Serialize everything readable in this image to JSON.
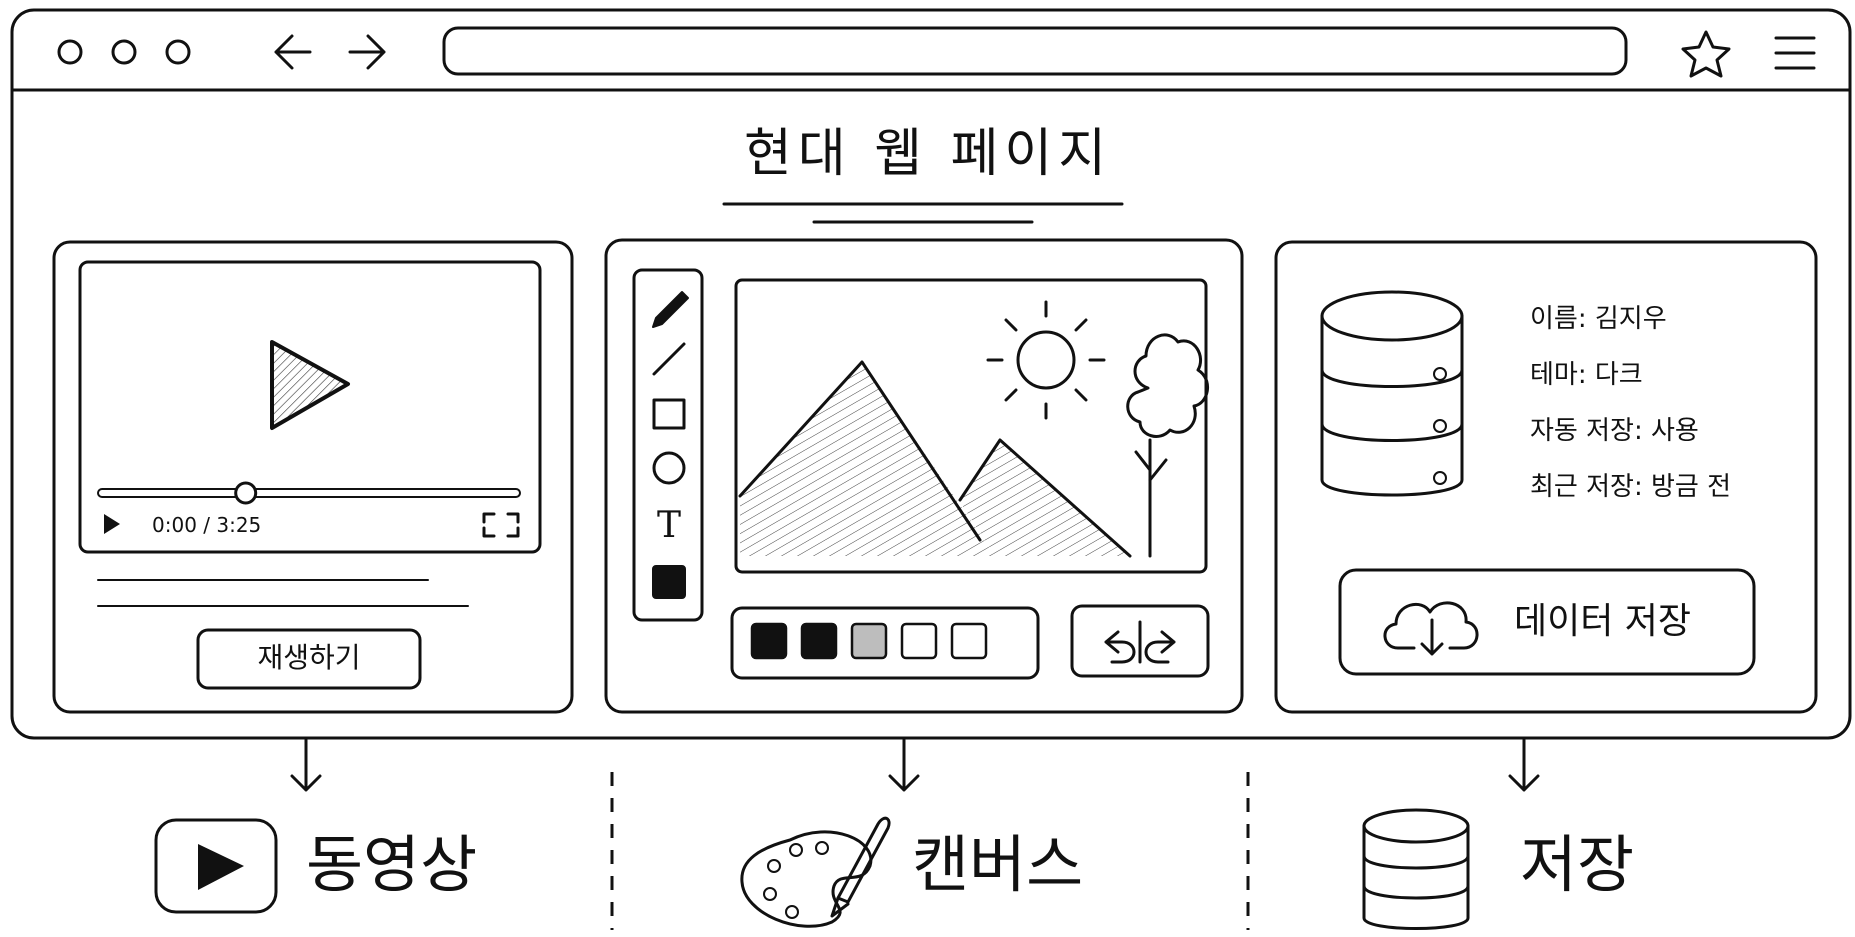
{
  "page_title": "현대 웹 페이지",
  "browser": {
    "window_dots": [
      "dot",
      "dot",
      "dot"
    ],
    "icons": [
      "back-arrow-icon",
      "forward-arrow-icon",
      "star-icon",
      "menu-icon"
    ]
  },
  "video_panel": {
    "time": "0:00 / 3:25",
    "progress_fraction": 0.35,
    "play_button_label": "재생하기"
  },
  "canvas_panel": {
    "tools": [
      "pencil-icon",
      "line-icon",
      "rectangle-icon",
      "circle-icon",
      "text-tool-icon",
      "fill-color-icon"
    ],
    "text_tool_glyph": "T",
    "swatches": [
      "#111111",
      "#111111",
      "#bdbdbd",
      "#ffffff",
      "#ffffff"
    ]
  },
  "storage_panel": {
    "rows": [
      {
        "key": "이름",
        "value": "김지우"
      },
      {
        "key": "테마",
        "value": "다크"
      },
      {
        "key": "자동 저장",
        "value": "사용"
      },
      {
        "key": "최근 저장",
        "value": "방금 전"
      }
    ],
    "row_text": [
      "이름:  김지우",
      "테마:  다크",
      "자동 저장:  사용",
      "최근 저장:  방금 전"
    ],
    "save_button_label": "데이터 저장"
  },
  "legend": [
    {
      "label": "동영상",
      "icon": "video-play-icon"
    },
    {
      "label": "캔버스",
      "icon": "palette-brush-icon"
    },
    {
      "label": "저장",
      "icon": "database-icon"
    }
  ]
}
